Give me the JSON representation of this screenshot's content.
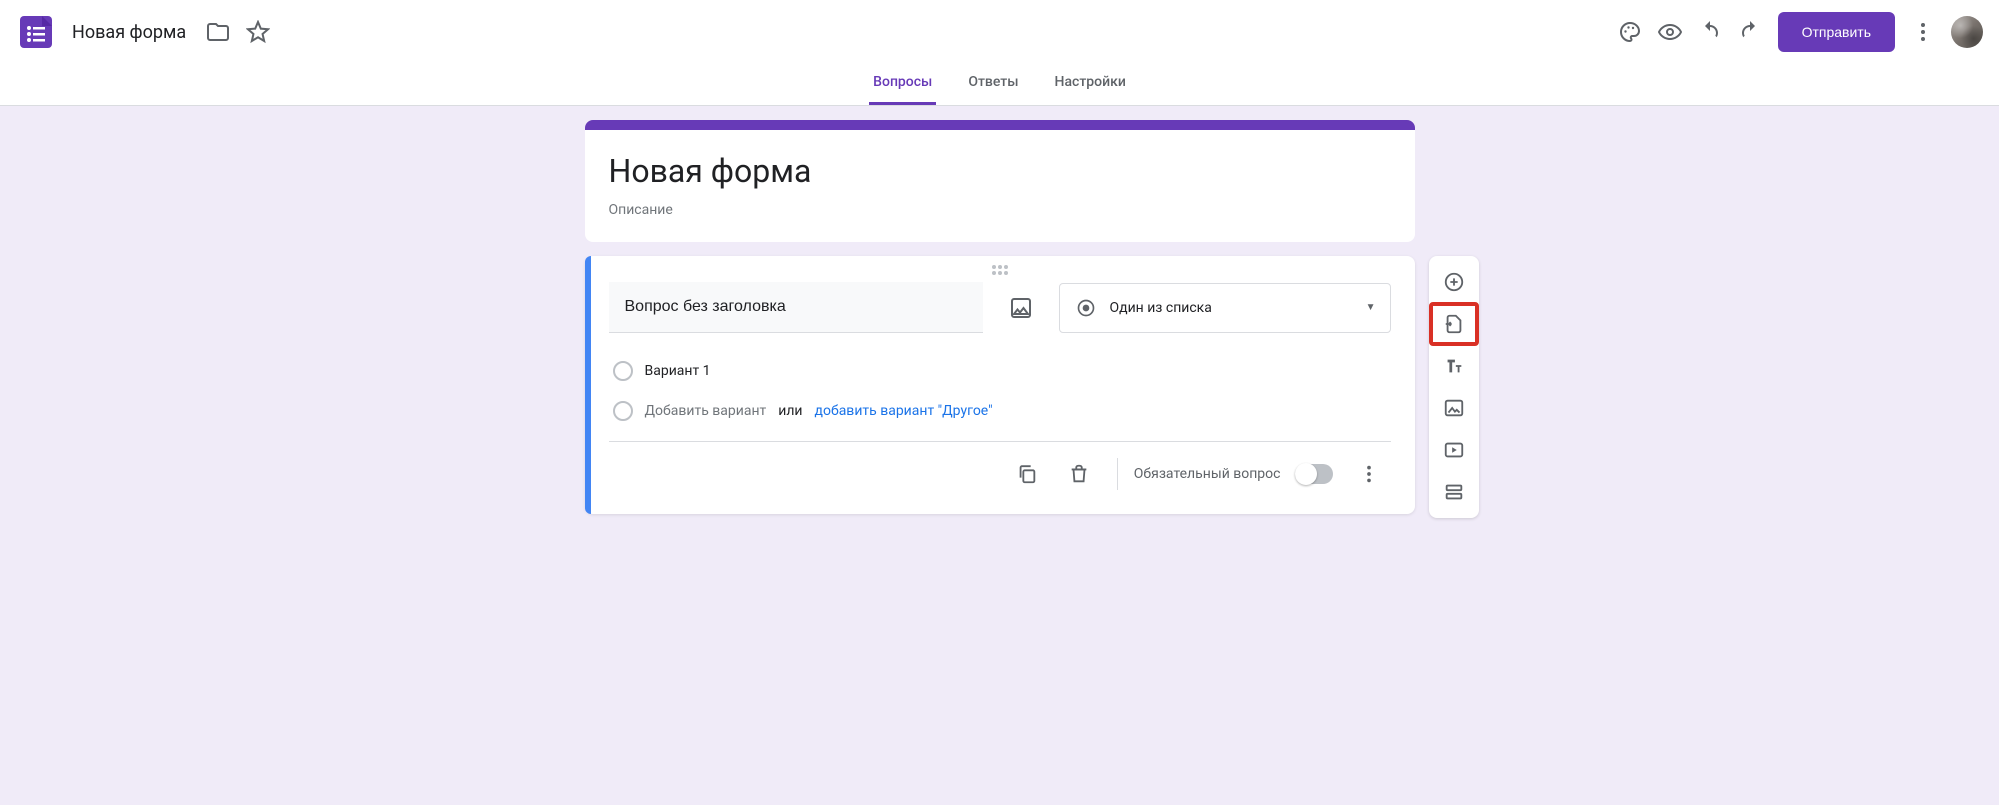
{
  "header": {
    "doc_title": "Новая форма",
    "send_label": "Отправить"
  },
  "tabs": {
    "questions": "Вопросы",
    "answers": "Ответы",
    "settings": "Настройки"
  },
  "form": {
    "title": "Новая форма",
    "description_placeholder": "Описание"
  },
  "question": {
    "title": "Вопрос без заголовка",
    "type_label": "Один из списка",
    "option1": "Вариант 1",
    "add_option": "Добавить вариант",
    "or": "или",
    "add_other": "добавить вариант \"Другое\"",
    "required_label": "Обязательный вопрос"
  },
  "side_toolbar": {
    "add_question": "add-question",
    "import_questions": "import-questions",
    "add_title": "add-title-description",
    "add_image": "add-image",
    "add_video": "add-video",
    "add_section": "add-section"
  }
}
